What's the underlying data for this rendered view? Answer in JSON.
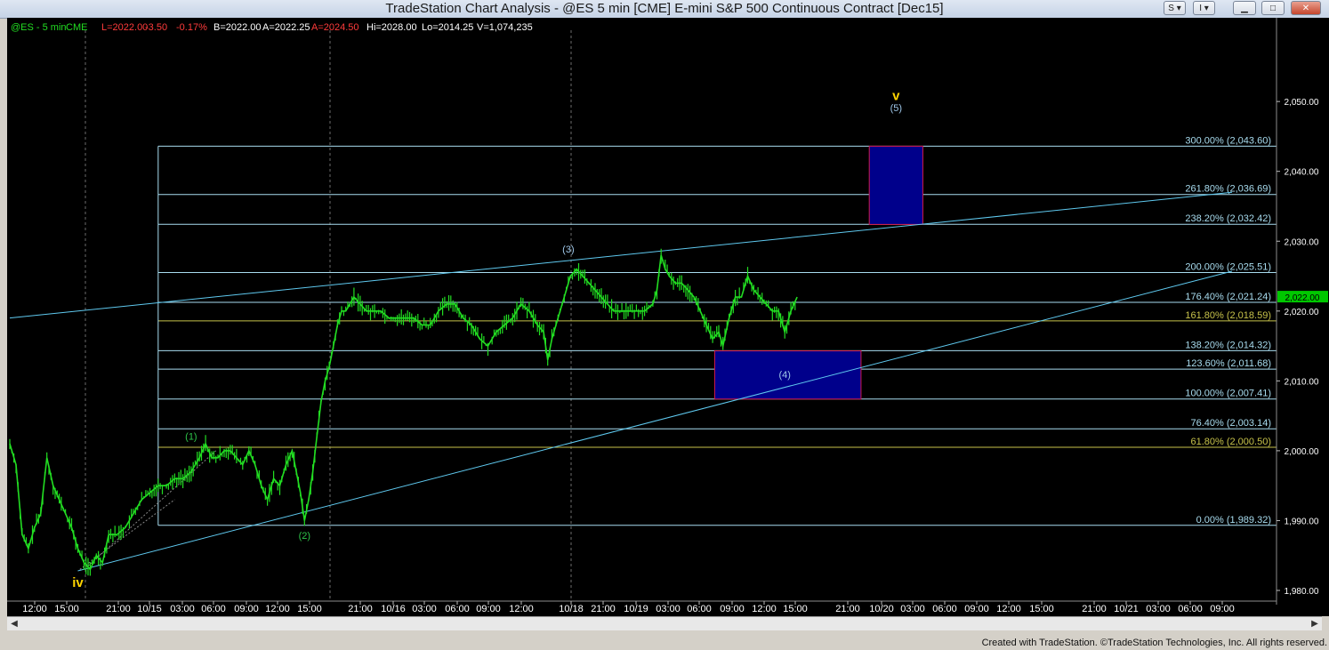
{
  "window": {
    "title": "TradeStation Chart Analysis - @ES 5 min [CME] E-mini S&P 500 Continuous Contract [Dec15]",
    "buttons": [
      "S",
      "I"
    ]
  },
  "header": {
    "symbol": "@ES - 5 min",
    "exchange": "CME",
    "last": "L=2022.00",
    "net": "-3.50",
    "pct": "-0.17%",
    "bid": "B=2022.00",
    "ask": "A=2022.25",
    "ask2": "A=2024.50",
    "high": "Hi=2028.00",
    "low": "Lo=2014.25",
    "volume": "V=1,074,235"
  },
  "footer": "Created with TradeStation. ©TradeStation Technologies, Inc. All rights reserved.",
  "colors": {
    "price": "#22dd22",
    "fib": "#a8dcef",
    "fib_gold": "#c7c24a",
    "trend": "#5fc9ef",
    "box_fill": "#00008b",
    "box_border": "#d21a4c",
    "wave_major": "#ffd400",
    "wave_green": "#2ec64a",
    "wave_blue": "#9fc8ea",
    "last_price_bg": "#00c800"
  },
  "chart_data": {
    "type": "line",
    "title": "",
    "xlabel": "",
    "ylabel": "",
    "ylim": [
      1977,
      2060
    ],
    "bars_per_hour": 12,
    "y_ticks": [
      "1,980.00",
      "1,990.00",
      "2,000.00",
      "2,010.00",
      "2,020.00",
      "2,030.00",
      "2,040.00",
      "2,050.00"
    ],
    "x_ticks": [
      "12:00",
      "15:00",
      "21:00",
      "10/15",
      "03:00",
      "06:00",
      "09:00",
      "12:00",
      "15:00",
      "21:00",
      "10/16",
      "03:00",
      "06:00",
      "09:00",
      "12:00",
      "10/18",
      "21:00",
      "10/19",
      "03:00",
      "06:00",
      "09:00",
      "12:00",
      "15:00",
      "21:00",
      "10/20",
      "03:00",
      "06:00",
      "09:00",
      "12:00",
      "15:00",
      "21:00",
      "10/21",
      "03:00",
      "06:00",
      "09:00"
    ],
    "last_price_label": "2,022.00",
    "series": [
      {
        "values": [
          [
            0,
            2001
          ],
          [
            3,
            1998
          ],
          [
            6,
            1988
          ],
          [
            9,
            1986
          ],
          [
            12,
            1989
          ],
          [
            15,
            1991
          ],
          [
            18,
            1999
          ],
          [
            21,
            1995
          ],
          [
            24,
            1993
          ],
          [
            27,
            1991
          ],
          [
            30,
            1989
          ],
          [
            33,
            1986
          ],
          [
            36,
            1984
          ],
          [
            39,
            1983
          ],
          [
            42,
            1985
          ],
          [
            45,
            1984
          ],
          [
            48,
            1988
          ],
          [
            52,
            1988
          ],
          [
            56,
            1989
          ],
          [
            60,
            1991
          ],
          [
            64,
            1993
          ],
          [
            68,
            1994
          ],
          [
            72,
            1995
          ],
          [
            76,
            1995
          ],
          [
            80,
            1996
          ],
          [
            84,
            1996
          ],
          [
            88,
            1997
          ],
          [
            92,
            1999
          ],
          [
            95,
            2001
          ],
          [
            98,
            1999
          ],
          [
            101,
            1999
          ],
          [
            104,
            2000
          ],
          [
            107,
            2000
          ],
          [
            110,
            1999
          ],
          [
            113,
            1998
          ],
          [
            116,
            2000
          ],
          [
            119,
            1998
          ],
          [
            122,
            1995
          ],
          [
            125,
            1993
          ],
          [
            128,
            1996
          ],
          [
            131,
            1995
          ],
          [
            134,
            1998
          ],
          [
            137,
            2000
          ],
          [
            139,
            1997
          ],
          [
            141,
            1994
          ],
          [
            143,
            1990
          ],
          [
            145,
            1993
          ],
          [
            147,
            1997
          ],
          [
            149,
            2002
          ],
          [
            151,
            2007
          ],
          [
            153,
            2010
          ],
          [
            155,
            2012
          ],
          [
            157,
            2015
          ],
          [
            159,
            2018
          ],
          [
            161,
            2020
          ],
          [
            163,
            2020
          ],
          [
            165,
            2021
          ],
          [
            167,
            2022
          ],
          [
            170,
            2021
          ],
          [
            173,
            2020
          ],
          [
            176,
            2020
          ],
          [
            180,
            2020
          ],
          [
            184,
            2019
          ],
          [
            188,
            2019
          ],
          [
            192,
            2019
          ],
          [
            196,
            2019
          ],
          [
            200,
            2018
          ],
          [
            204,
            2018
          ],
          [
            208,
            2020
          ],
          [
            212,
            2021
          ],
          [
            216,
            2021
          ],
          [
            220,
            2019
          ],
          [
            224,
            2018
          ],
          [
            228,
            2016
          ],
          [
            232,
            2015
          ],
          [
            236,
            2017
          ],
          [
            240,
            2018
          ],
          [
            244,
            2019
          ],
          [
            248,
            2021
          ],
          [
            252,
            2020
          ],
          [
            256,
            2018
          ],
          [
            259,
            2017
          ],
          [
            261,
            2013
          ],
          [
            263,
            2016
          ],
          [
            266,
            2019
          ],
          [
            269,
            2022
          ],
          [
            272,
            2025
          ],
          [
            275,
            2026
          ],
          [
            278,
            2025
          ],
          [
            281,
            2024
          ],
          [
            284,
            2023
          ],
          [
            287,
            2022
          ],
          [
            290,
            2021
          ],
          [
            293,
            2020
          ],
          [
            296,
            2020
          ],
          [
            300,
            2020
          ],
          [
            304,
            2020
          ],
          [
            308,
            2020
          ],
          [
            312,
            2021
          ],
          [
            314,
            2023
          ],
          [
            316,
            2028
          ],
          [
            318,
            2026
          ],
          [
            320,
            2025
          ],
          [
            323,
            2024
          ],
          [
            326,
            2024
          ],
          [
            329,
            2023
          ],
          [
            332,
            2022
          ],
          [
            335,
            2020
          ],
          [
            338,
            2018
          ],
          [
            341,
            2016
          ],
          [
            344,
            2017
          ],
          [
            346,
            2015
          ],
          [
            349,
            2019
          ],
          [
            352,
            2022
          ],
          [
            355,
            2022
          ],
          [
            358,
            2025
          ],
          [
            361,
            2023
          ],
          [
            364,
            2022
          ],
          [
            367,
            2021
          ],
          [
            370,
            2020
          ],
          [
            373,
            2020
          ],
          [
            376,
            2017
          ],
          [
            379,
            2020
          ],
          [
            382,
            2022
          ]
        ]
      }
    ],
    "fib_levels": [
      {
        "label": "0.00% (1,989.32)",
        "value": 1989.32
      },
      {
        "label": "61.80% (2,000.50)",
        "value": 2000.5
      },
      {
        "label": "76.40% (2,003.14)",
        "value": 2003.14
      },
      {
        "label": "100.00% (2,007.41)",
        "value": 2007.41
      },
      {
        "label": "123.60% (2,011.68)",
        "value": 2011.68
      },
      {
        "label": "138.20% (2,014.32)",
        "value": 2014.32
      },
      {
        "label": "161.80% (2,018.59)",
        "value": 2018.59
      },
      {
        "label": "176.40% (2,021.24)",
        "value": 2021.24
      },
      {
        "label": "200.00% (2,025.51)",
        "value": 2025.51
      },
      {
        "label": "238.20% (2,032.42)",
        "value": 2032.42
      },
      {
        "label": "261.80% (2,036.69)",
        "value": 2036.69
      },
      {
        "label": "300.00% (2,043.60)",
        "value": 2043.6
      }
    ],
    "fib_start_bar": 72,
    "trend_lines": [
      {
        "x1": 0,
        "y1": 2019.0,
        "x2": 593,
        "y2": 2037.0
      },
      {
        "x1": 33,
        "y1": 1982.8,
        "x2": 593,
        "y2": 2025.7
      }
    ],
    "target_boxes": [
      {
        "x1": 342,
        "x2": 413,
        "y1": 2007.4,
        "y2": 2014.3
      },
      {
        "x1": 417,
        "x2": 443,
        "y1": 2032.4,
        "y2": 2043.6
      }
    ],
    "wave_labels": [
      {
        "text": "iv",
        "bar": 33,
        "price": 1980.5,
        "kind": "major"
      },
      {
        "text": "v",
        "bar": 430,
        "price": 2050.2,
        "kind": "major"
      },
      {
        "text": "(5)",
        "bar": 430,
        "price": 2048.6,
        "kind": "blue"
      },
      {
        "text": "(1)",
        "bar": 88,
        "price": 2001.6,
        "kind": "green"
      },
      {
        "text": "(2)",
        "bar": 143,
        "price": 1987.4,
        "kind": "green"
      },
      {
        "text": "(3)",
        "bar": 271,
        "price": 2028.4,
        "kind": "blue"
      },
      {
        "text": "(4)",
        "bar": 376,
        "price": 2010.4,
        "kind": "blue"
      }
    ]
  }
}
